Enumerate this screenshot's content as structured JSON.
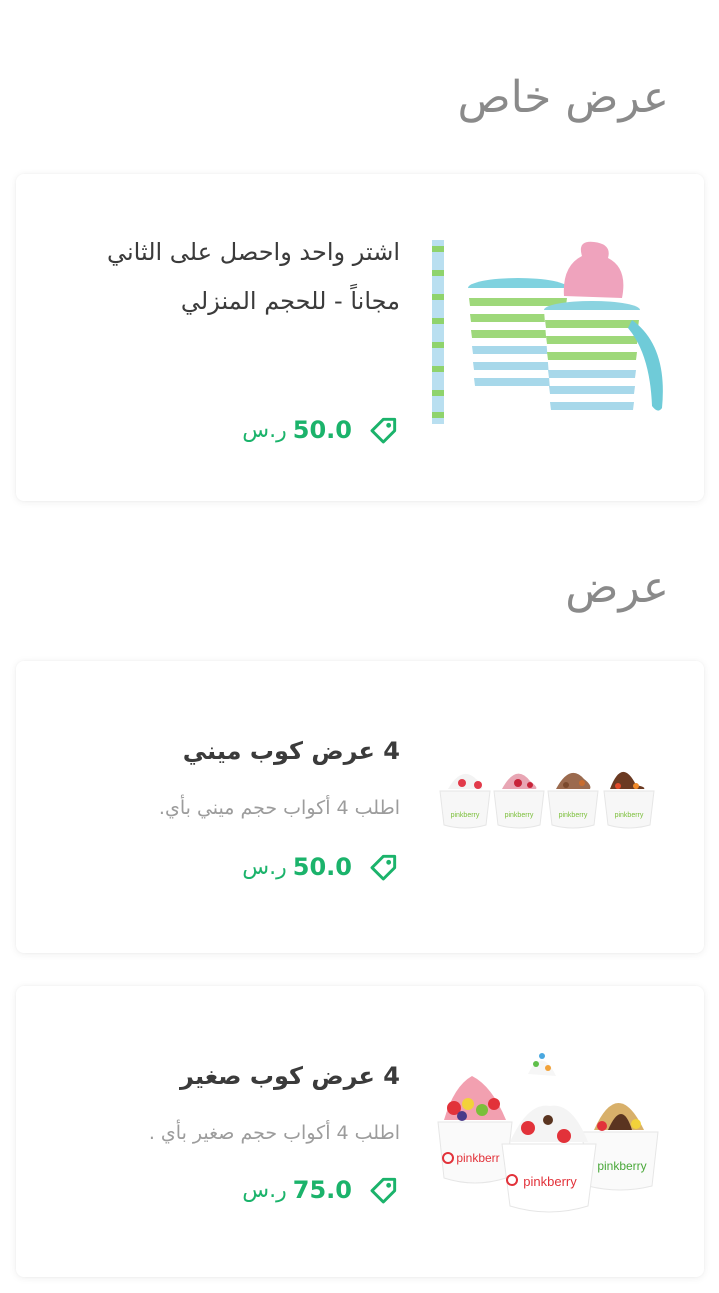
{
  "sections": {
    "special_title": "عرض خاص",
    "offers_title": "عرض"
  },
  "offers": [
    {
      "title": "اشتر واحد واحصل على الثاني مجاناً - للحجم المنزلي",
      "description": "",
      "price": "50.0",
      "currency": "ر.س"
    },
    {
      "title": "4 عرض كوب ميني",
      "description": "اطلب 4 أكواب حجم ميني بأي.",
      "price": "50.0",
      "currency": "ر.س"
    },
    {
      "title": "4 عرض كوب صغير",
      "description": "اطلب 4 أكواب حجم صغير بأي .",
      "price": "75.0",
      "currency": "ر.س"
    }
  ],
  "brand_text": "pinkberry",
  "colors": {
    "accent": "#1bb36b",
    "title": "#3b3b3b",
    "muted": "#9c9c9c",
    "section": "#8a8a8a"
  },
  "icons": {
    "price": "price-tag-icon"
  }
}
